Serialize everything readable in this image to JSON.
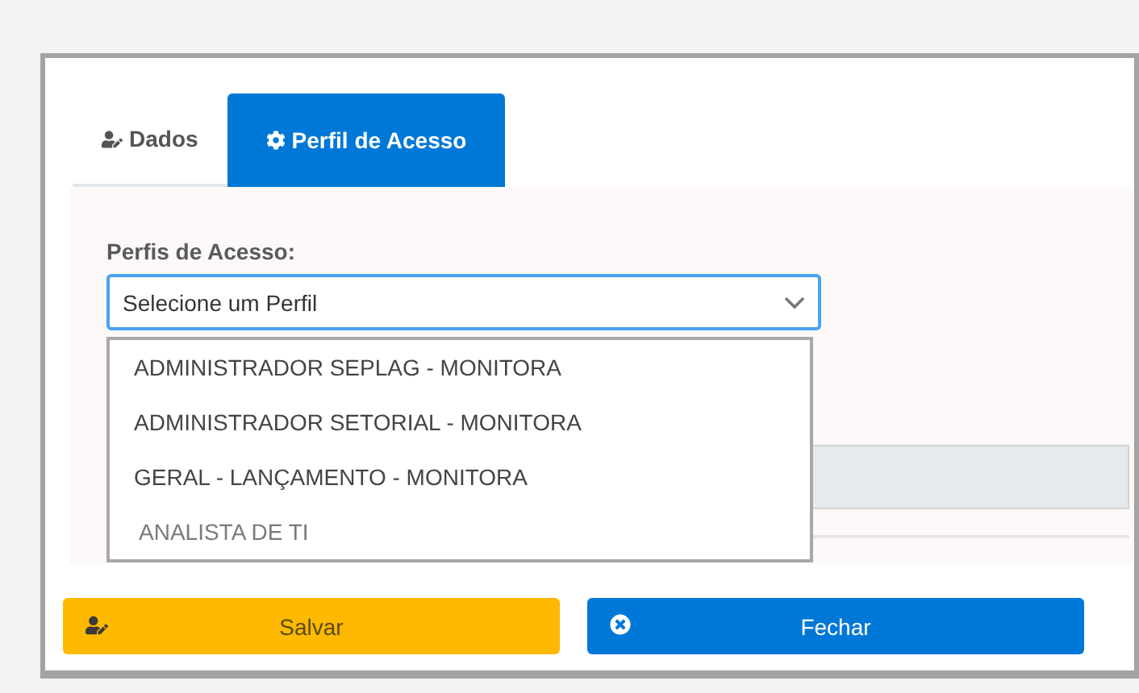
{
  "tabs": [
    {
      "label": "Dados",
      "kind": "user",
      "selected": false
    },
    {
      "label": "Perfil de Acesso",
      "kind": "gear",
      "selected": true
    }
  ],
  "form": {
    "label": "Perfis de Acesso:",
    "select": {
      "value": "Selecione um Perfil",
      "expanded": true
    },
    "options": [
      {
        "label": "ADMINISTRADOR SEPLAG - MONITORA",
        "disabled": false
      },
      {
        "label": "ADMINISTRADOR SETORIAL - MONITORA",
        "disabled": false
      },
      {
        "label": "GERAL - LANÇAMENTO - MONITORA",
        "disabled": false
      },
      {
        "label": "ANALISTA DE TI",
        "disabled": true
      }
    ]
  },
  "buttons": [
    {
      "label": "Salvar",
      "kind": "save"
    },
    {
      "label": "Fechar",
      "kind": "close"
    }
  ]
}
